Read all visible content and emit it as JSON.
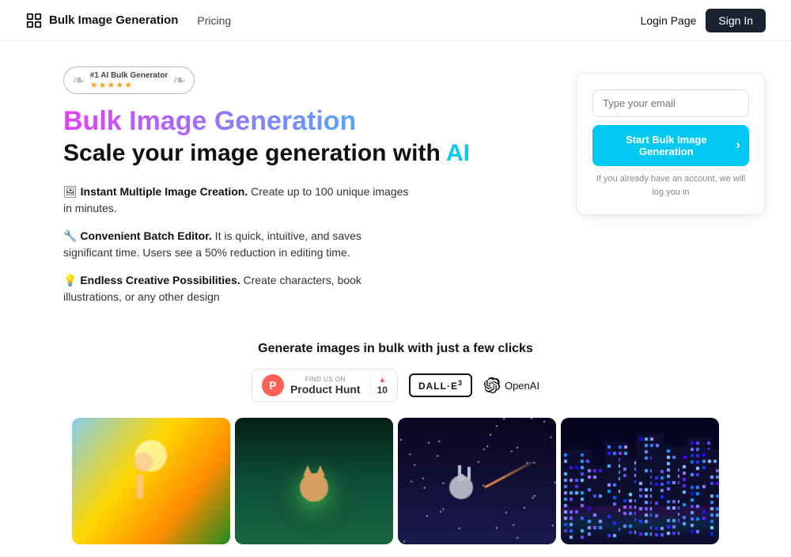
{
  "nav": {
    "logo_text": "Bulk Image Generation",
    "pricing_label": "Pricing",
    "login_label": "Login Page",
    "signin_label": "Sign In"
  },
  "hero": {
    "badge_rank": "#1 AI Bulk Generator",
    "badge_stars": "★★★★★",
    "title_top": "Bulk Image Generation",
    "title_main_prefix": "Scale your image generation with ",
    "title_main_ai": "AI",
    "features": [
      {
        "emoji": "🖼",
        "bold": "Instant Multiple Image Creation.",
        "text": " Create up to 100 unique images in minutes."
      },
      {
        "emoji": "🔧",
        "bold": "Convenient Batch Editor.",
        "text": " It is quick, intuitive, and saves significant time. Users see a 50% reduction in editing time."
      },
      {
        "emoji": "💡",
        "bold": "Endless Creative Possibilities.",
        "text": " Create characters, book illustrations, or any other design"
      }
    ]
  },
  "bottom": {
    "heading": "Generate images in bulk with just a few clicks"
  },
  "product_hunt": {
    "circle_letter": "P",
    "top_line": "FIND US ON",
    "name": "Product Hunt",
    "vote_count": "10"
  },
  "dalle": {
    "label": "DALL·E 3"
  },
  "openai": {
    "label": "OpenAI"
  },
  "signup": {
    "email_placeholder": "Type your email",
    "button_label": "Start Bulk Image Generation",
    "note": "If you already have an account, we will log you in"
  },
  "images": [
    {
      "desc": "woman beach tropical",
      "colors": [
        "#87ceeb",
        "#ffd700",
        "#228b22",
        "#ff8c00"
      ]
    },
    {
      "desc": "cat forest magical",
      "colors": [
        "#0d4f3c",
        "#2d8a5e",
        "#1a6640",
        "#90ee90"
      ]
    },
    {
      "desc": "bunny space",
      "colors": [
        "#1a1a3e",
        "#6a5acd",
        "#9370db",
        "#c0c0c0"
      ]
    },
    {
      "desc": "city night neon",
      "colors": [
        "#0a0a1a",
        "#1a1a3e",
        "#ff00ff",
        "#00ffff"
      ]
    }
  ]
}
